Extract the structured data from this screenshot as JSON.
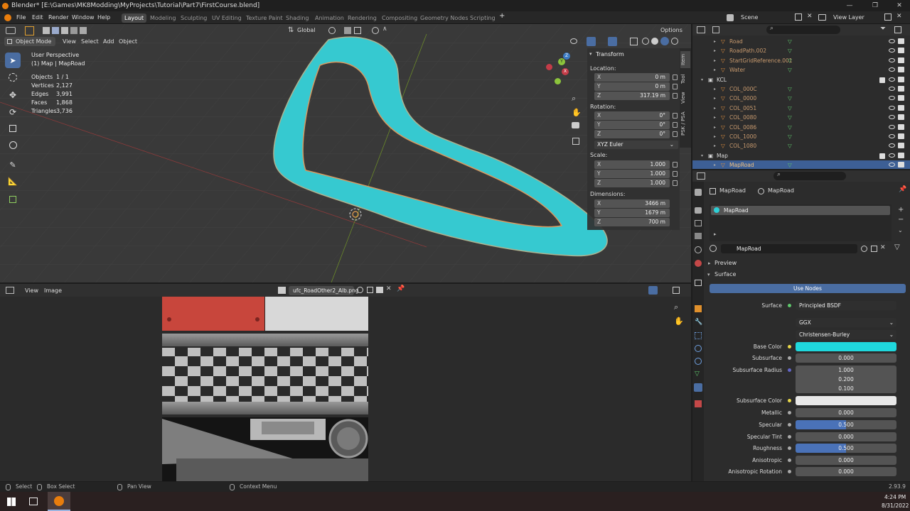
{
  "app": {
    "title": "Blender* [E:\\Games\\MK8Modding\\MyProjects\\Tutorial\\Part7\\FirstCourse.blend]",
    "menus": [
      "File",
      "Edit",
      "Render",
      "Window",
      "Help"
    ],
    "workspaces": [
      "Layout",
      "Modeling",
      "Sculpting",
      "UV Editing",
      "Texture Paint",
      "Shading",
      "Animation",
      "Rendering",
      "Compositing",
      "Geometry Nodes",
      "Scripting"
    ],
    "active_workspace": "Layout",
    "scene": "Scene",
    "view_layer": "View Layer"
  },
  "viewport": {
    "mode": "Object Mode",
    "menus": [
      "View",
      "Select",
      "Add",
      "Object"
    ],
    "orientation": "Global",
    "options_label": "Options",
    "perspective_label": "User Perspective",
    "context_label": "(1) Map | MapRoad",
    "stats": [
      {
        "label": "Objects",
        "value": "1 / 1"
      },
      {
        "label": "Vertices",
        "value": "2,127"
      },
      {
        "label": "Edges",
        "value": "3,991"
      },
      {
        "label": "Faces",
        "value": "1,868"
      },
      {
        "label": "Triangles",
        "value": "3,736"
      }
    ],
    "road_color": "#2ecfd6",
    "gizmo_axes": [
      "X",
      "Y",
      "Z"
    ]
  },
  "npanel": {
    "title": "Transform",
    "location_label": "Location:",
    "location": [
      {
        "axis": "X",
        "value": "0 m"
      },
      {
        "axis": "Y",
        "value": "0 m"
      },
      {
        "axis": "Z",
        "value": "317.19 m"
      }
    ],
    "rotation_label": "Rotation:",
    "rotation": [
      {
        "axis": "X",
        "value": "0°"
      },
      {
        "axis": "Y",
        "value": "0°"
      },
      {
        "axis": "Z",
        "value": "0°"
      }
    ],
    "rotation_mode": "XYZ Euler",
    "scale_label": "Scale:",
    "scale": [
      {
        "axis": "X",
        "value": "1.000"
      },
      {
        "axis": "Y",
        "value": "1.000"
      },
      {
        "axis": "Z",
        "value": "1.000"
      }
    ],
    "dimensions_label": "Dimensions:",
    "dimensions": [
      {
        "axis": "X",
        "value": "3466 m"
      },
      {
        "axis": "Y",
        "value": "1679 m"
      },
      {
        "axis": "Z",
        "value": "700 m"
      }
    ],
    "tabs": [
      "Item",
      "Tool",
      "View",
      "PSK / PSA"
    ]
  },
  "image_editor": {
    "menus": [
      "View",
      "Image"
    ],
    "image_name": "ufc_RoadOther2_Alb.png"
  },
  "outliner": {
    "rows": [
      {
        "name": "Road",
        "indent": 1
      },
      {
        "name": "RoadPath.002",
        "indent": 1
      },
      {
        "name": "StartGridReference.001",
        "indent": 1
      },
      {
        "name": "Water",
        "indent": 1
      },
      {
        "name": "KCL",
        "indent": 0,
        "collection": true
      },
      {
        "name": "COL_000C",
        "indent": 1
      },
      {
        "name": "COL_0000",
        "indent": 1
      },
      {
        "name": "COL_0051",
        "indent": 1
      },
      {
        "name": "COL_0080",
        "indent": 1
      },
      {
        "name": "COL_0086",
        "indent": 1
      },
      {
        "name": "COL_1000",
        "indent": 1
      },
      {
        "name": "COL_1080",
        "indent": 1
      },
      {
        "name": "Map",
        "indent": 0,
        "collection": true
      },
      {
        "name": "MapRoad",
        "indent": 1,
        "selected": true
      }
    ]
  },
  "properties": {
    "object_name": "MapRoad",
    "material_name": "MapRoad",
    "slot_name": "MapRoad",
    "material_field": "MapRoad",
    "preview_label": "Preview",
    "surface_label": "Surface",
    "use_nodes_label": "Use Nodes",
    "surface_shader_label": "Surface",
    "surface_shader": "Principled BSDF",
    "distribution": "GGX",
    "subsurface_method": "Christensen-Burley",
    "base_color_label": "Base Color",
    "base_color": "#1fd8dd",
    "subsurface_label": "Subsurface",
    "subsurface": "0.000",
    "subsurface_radius_label": "Subsurface Radius",
    "subsurface_radius": [
      "1.000",
      "0.200",
      "0.100"
    ],
    "subsurface_color_label": "Subsurface Color",
    "subsurface_color": "#e8e8e8",
    "metallic_label": "Metallic",
    "metallic": "0.000",
    "specular_label": "Specular",
    "specular": "0.500",
    "specular_fill": 0.5,
    "specular_tint_label": "Specular Tint",
    "specular_tint": "0.000",
    "roughness_label": "Roughness",
    "roughness": "0.500",
    "roughness_fill": 0.5,
    "anisotropic_label": "Anisotropic",
    "anisotropic": "0.000",
    "anisotropic_rotation_label": "Anisotropic Rotation",
    "anisotropic_rotation": "0.000"
  },
  "statusbar": {
    "select": "Select",
    "box_select": "Box Select",
    "pan_view": "Pan View",
    "context_menu": "Context Menu",
    "version": "2.93.9"
  },
  "taskbar": {
    "time": "4:24 PM",
    "date": "8/31/2022"
  }
}
